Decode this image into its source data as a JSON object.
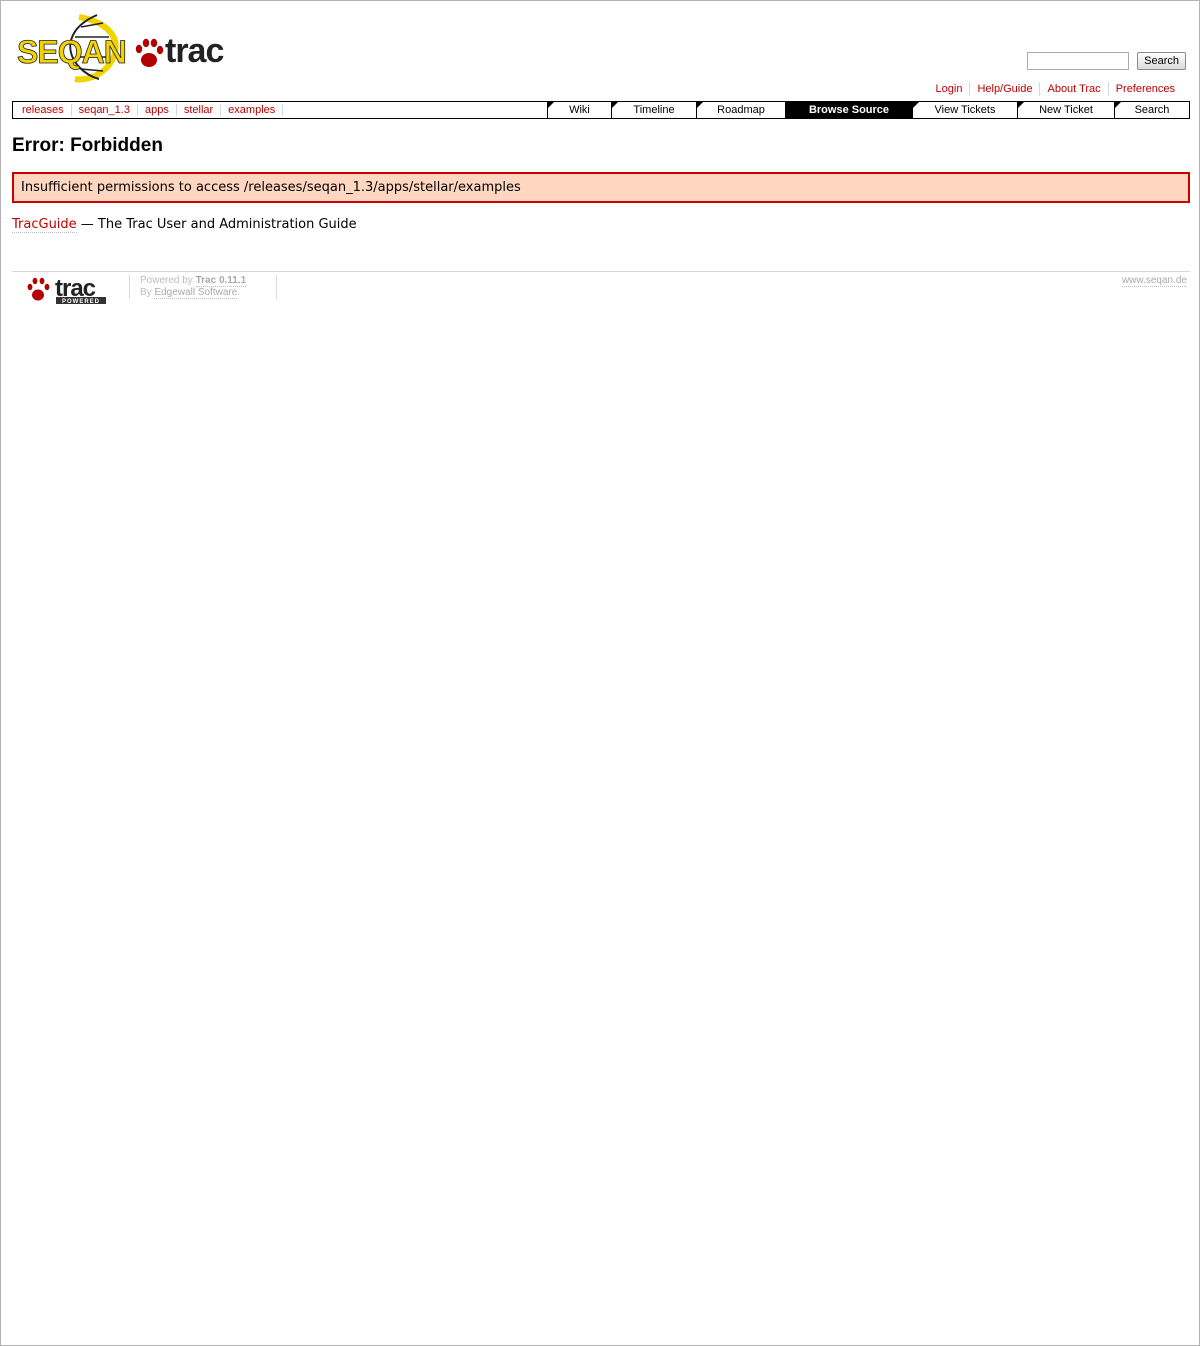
{
  "header": {
    "search": {
      "placeholder": "",
      "value": "",
      "button_label": "Search"
    },
    "metanav": [
      "Login",
      "Help/Guide",
      "About Trac",
      "Preferences"
    ]
  },
  "path": [
    "releases",
    "seqan_1.3",
    "apps",
    "stellar",
    "examples"
  ],
  "mainnav": [
    {
      "label": "Wiki",
      "active": false
    },
    {
      "label": "Timeline",
      "active": false
    },
    {
      "label": "Roadmap",
      "active": false
    },
    {
      "label": "Browse Source",
      "active": true
    },
    {
      "label": "View Tickets",
      "active": false
    },
    {
      "label": "New Ticket",
      "active": false
    },
    {
      "label": "Search",
      "active": false
    }
  ],
  "content": {
    "title": "Error: Forbidden",
    "message": "Insufficient permissions to access /releases/seqan_1.3/apps/stellar/examples",
    "guide_link": "TracGuide",
    "guide_text": " — The Trac User and Administration Guide"
  },
  "footer": {
    "powered_prefix": "Powered by ",
    "powered_link": "Trac 0.11.1",
    "by_prefix": "By ",
    "by_link": "Edgewall Software",
    "by_suffix": ".",
    "site_link": "www.seqan.de"
  },
  "logo": {
    "seqan_text": "SEQAN",
    "trac_text": "trac",
    "powered_text": "POWERED"
  },
  "colors": {
    "link": "#bb0000",
    "error_bg": "#ffd6c0",
    "error_border": "#cc0000",
    "seqan_yellow": "#f2d300",
    "paw_red": "#b30000"
  }
}
